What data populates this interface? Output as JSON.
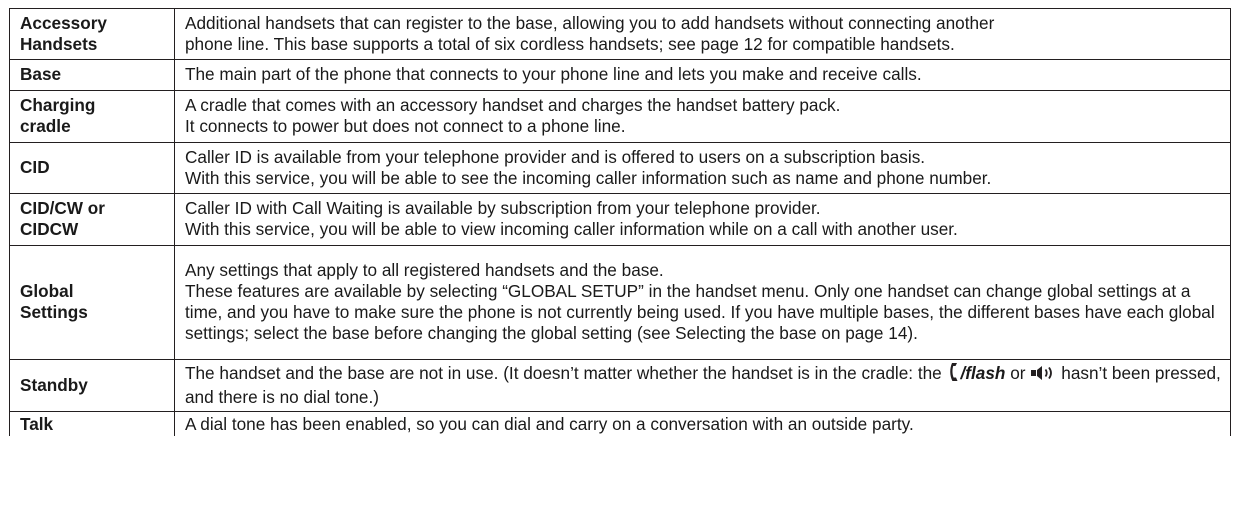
{
  "glossary": [
    {
      "term": [
        "Accessory",
        "Handsets"
      ],
      "definition": [
        "Additional handsets that can register to the base, allowing you to add handsets without connecting another",
        "phone line. This base supports a total of six cordless handsets; see page 12 for compatible handsets."
      ]
    },
    {
      "term": [
        "Base"
      ],
      "definition": [
        "The main part of the phone that connects to your phone line and lets you make and receive calls."
      ]
    },
    {
      "term": [
        "Charging",
        "cradle"
      ],
      "definition": [
        "A cradle that comes with an accessory handset and charges the handset battery pack.",
        "It connects to power but does not connect to a phone line."
      ]
    },
    {
      "term": [
        "CID"
      ],
      "definition": [
        "Caller ID is available from your telephone provider and is offered to users on a subscription basis.",
        "With this service, you will be able to see the incoming caller information such as name and phone number."
      ]
    },
    {
      "term": [
        "CID/CW or",
        "CIDCW"
      ],
      "definition": [
        "Caller ID with Call Waiting is available by subscription from your telephone provider.",
        "With this service, you will be able to view incoming caller information while on a call with another user."
      ]
    },
    {
      "term": [
        "Global",
        "Settings"
      ],
      "definition": [
        "Any settings that apply to all registered handsets and the base.",
        "These features are available by selecting “GLOBAL SETUP” in the handset menu. Only one handset can change global settings at a time, and you have to make sure the phone is not currently being used. If you have multiple bases, the different bases have each global settings; select the base before changing the global setting (see Selecting the base on page 14)."
      ]
    },
    {
      "term": [
        "Standby"
      ],
      "definition_before": "The handset and the base are not in use. (It doesn’t matter whether the handset is in the cradle: the",
      "flash_key": "/flash",
      "definition_middle": "or",
      "definition_after": "hasn’t been pressed, and there is no dial tone.)",
      "icons": [
        "talk-flash-key-icon",
        "speaker-key-icon"
      ]
    },
    {
      "term": [
        "Talk"
      ],
      "definition": [
        "A dial tone has been enabled, so you can dial and carry on a conversation with an outside party."
      ]
    }
  ]
}
